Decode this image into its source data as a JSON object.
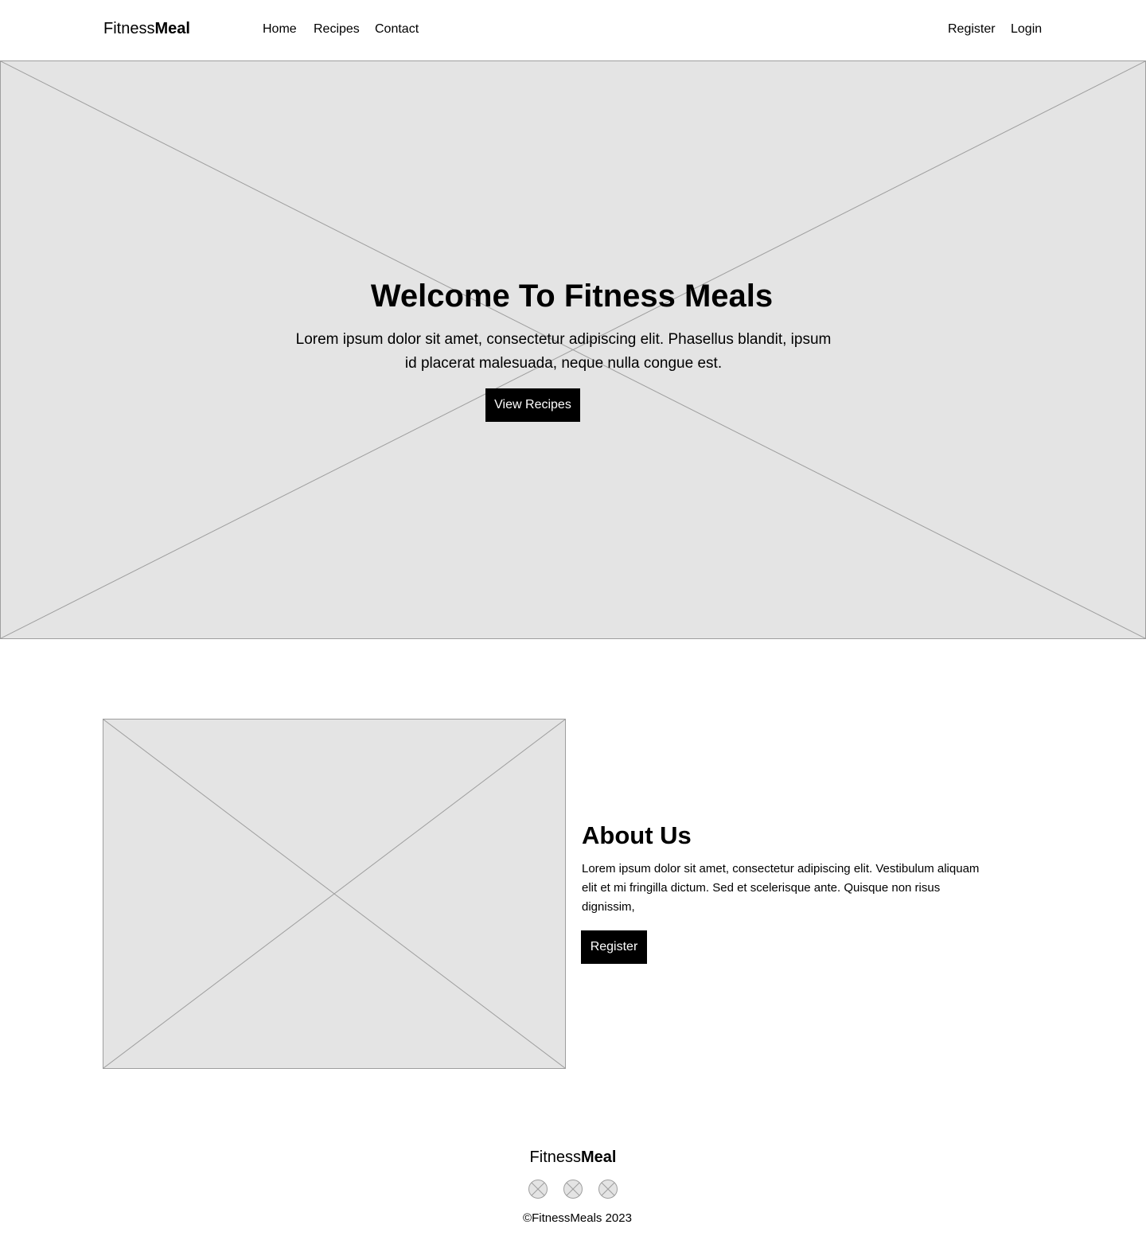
{
  "header": {
    "logo": {
      "light": "Fitness",
      "bold": "Meal"
    },
    "nav": {
      "home": "Home",
      "recipes": "Recipes",
      "contact": "Contact"
    },
    "auth": {
      "register": "Register",
      "login": "Login"
    }
  },
  "hero": {
    "title": "Welcome To Fitness Meals",
    "text": "Lorem ipsum dolor sit amet, consectetur adipiscing elit. Phasellus blandit, ipsum id placerat malesuada, neque nulla congue est.",
    "button": "View Recipes"
  },
  "about": {
    "title": "About Us",
    "text": "Lorem ipsum dolor sit amet, consectetur adipiscing elit. Vestibulum aliquam elit et mi fringilla dictum. Sed et scelerisque ante. Quisque non risus dignissim,",
    "button": "Register"
  },
  "footer": {
    "logo": {
      "light": "Fitness",
      "bold": "Meal"
    },
    "social_icons": [
      "image-placeholder-icon",
      "image-placeholder-icon",
      "image-placeholder-icon"
    ],
    "copyright": "©FitnessMeals 2023"
  },
  "colors": {
    "placeholder_fill": "#e4e4e4",
    "placeholder_stroke": "#9e9e9e",
    "button_bg": "#000000",
    "button_text": "#ffffff"
  }
}
